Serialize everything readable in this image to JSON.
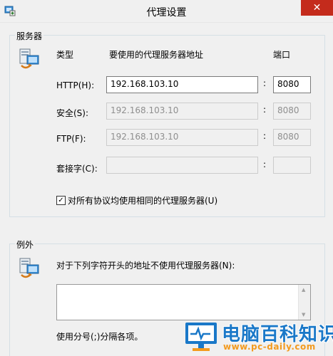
{
  "window": {
    "title": "代理设置",
    "close_glyph": "✕"
  },
  "servers": {
    "group_label": "服务器",
    "col_type": "类型",
    "col_address": "要使用的代理服务器地址",
    "col_port": "端口",
    "colon": ":",
    "rows": [
      {
        "label": "HTTP(H):",
        "address": "192.168.103.10",
        "port": "8080",
        "enabled": true
      },
      {
        "label": "安全(S):",
        "address": "192.168.103.10",
        "port": "8080",
        "enabled": false
      },
      {
        "label": "FTP(F):",
        "address": "192.168.103.10",
        "port": "8080",
        "enabled": false
      },
      {
        "label": "套接字(C):",
        "address": "",
        "port": "",
        "enabled": false
      }
    ],
    "same_proxy_checkbox": {
      "label": "对所有协议均使用相同的代理服务器(U)",
      "checked": true,
      "mark": "✓"
    }
  },
  "exceptions": {
    "group_label": "例外",
    "description": "对于下列字符开头的地址不使用代理服务器(N):",
    "list_value": "",
    "hint": "使用分号(;)分隔各项。"
  },
  "watermark": {
    "brand": "电脑百科知识",
    "url": "www.pc-daily.com"
  },
  "colors": {
    "close": "#c42b1c",
    "brand": "#1a78c8",
    "brand_orange": "#f39a1e"
  }
}
